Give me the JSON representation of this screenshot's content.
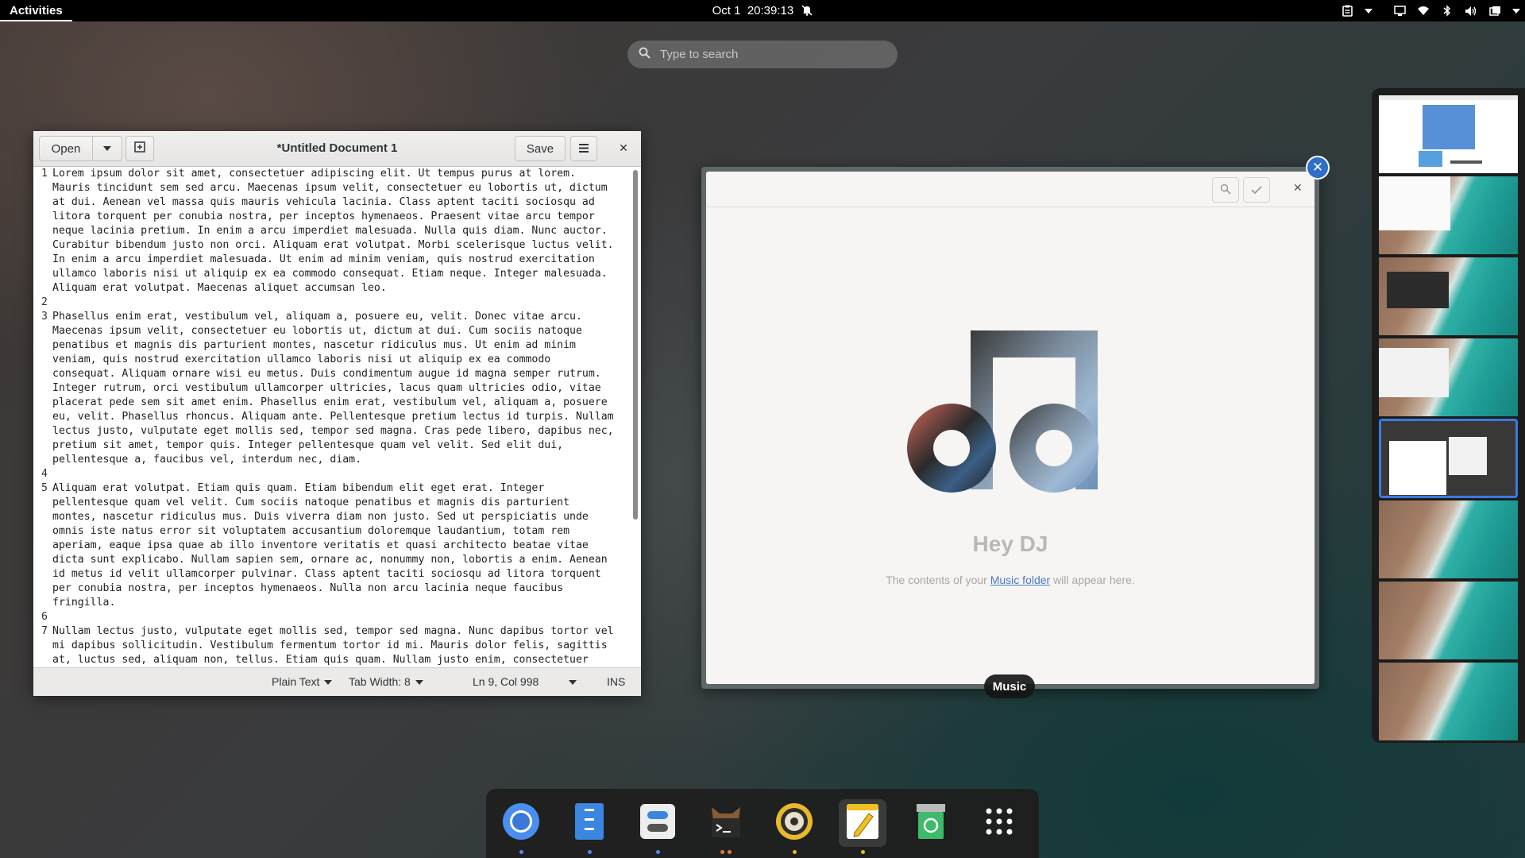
{
  "topbar": {
    "activities": "Activities",
    "date": "Oct 1",
    "time": "20:39:13",
    "icons": [
      "notifications-muted-icon",
      "clipboard-icon",
      "screen-icon",
      "wifi-icon",
      "bluetooth-icon",
      "volume-icon",
      "power-icon"
    ]
  },
  "search": {
    "placeholder": "Type to search"
  },
  "gedit": {
    "open_label": "Open",
    "save_label": "Save",
    "title": "*Untitled Document 1",
    "line_numbers": [
      "1",
      "",
      "",
      "",
      "",
      "",
      "",
      "",
      "",
      "2",
      "3",
      "",
      "",
      "",
      "",
      "",
      "",
      "",
      "",
      "",
      "",
      "4",
      "5",
      "",
      "",
      "",
      "",
      "",
      "",
      "",
      "",
      "6",
      "7",
      "",
      "",
      ""
    ],
    "paragraphs": [
      "Lorem ipsum dolor sit amet, consectetuer adipiscing elit. Ut tempus purus at lorem.\nMauris tincidunt sem sed arcu. Maecenas ipsum velit, consectetuer eu lobortis ut, dictum\nat dui. Aenean vel massa quis mauris vehicula lacinia. Class aptent taciti sociosqu ad\nlitora torquent per conubia nostra, per inceptos hymenaeos. Praesent vitae arcu tempor\nneque lacinia pretium. In enim a arcu imperdiet malesuada. Nulla quis diam. Nunc auctor.\nCurabitur bibendum justo non orci. Aliquam erat volutpat. Morbi scelerisque luctus velit.\nIn enim a arcu imperdiet malesuada. Ut enim ad minim veniam, quis nostrud exercitation\nullamco laboris nisi ut aliquip ex ea commodo consequat. Etiam neque. Integer malesuada.\nAliquam erat volutpat. Maecenas aliquet accumsan leo.",
      "Phasellus enim erat, vestibulum vel, aliquam a, posuere eu, velit. Donec vitae arcu.\nMaecenas ipsum velit, consectetuer eu lobortis ut, dictum at dui. Cum sociis natoque\npenatibus et magnis dis parturient montes, nascetur ridiculus mus. Ut enim ad minim\nveniam, quis nostrud exercitation ullamco laboris nisi ut aliquip ex ea commodo\nconsequat. Aliquam ornare wisi eu metus. Duis condimentum augue id magna semper rutrum.\nInteger rutrum, orci vestibulum ullamcorper ultricies, lacus quam ultricies odio, vitae\nplacerat pede sem sit amet enim. Phasellus enim erat, vestibulum vel, aliquam a, posuere\neu, velit. Phasellus rhoncus. Aliquam ante. Pellentesque pretium lectus id turpis. Nullam\nlectus justo, vulputate eget mollis sed, tempor sed magna. Cras pede libero, dapibus nec,\npretium sit amet, tempor quis. Integer pellentesque quam vel velit. Sed elit dui,\npellentesque a, faucibus vel, interdum nec, diam.",
      "Aliquam erat volutpat. Etiam quis quam. Etiam bibendum elit eget erat. Integer\npellentesque quam vel velit. Cum sociis natoque penatibus et magnis dis parturient\nmontes, nascetur ridiculus mus. Duis viverra diam non justo. Sed ut perspiciatis unde\nomnis iste natus error sit voluptatem accusantium doloremque laudantium, totam rem\naperiam, eaque ipsa quae ab illo inventore veritatis et quasi architecto beatae vitae\ndicta sunt explicabo. Nullam sapien sem, ornare ac, nonummy non, lobortis a enim. Aenean\nid metus id velit ullamcorper pulvinar. Class aptent taciti sociosqu ad litora torquent\nper conubia nostra, per inceptos hymenaeos. Nulla non arcu lacinia neque faucibus\nfringilla.",
      "Nullam lectus justo, vulputate eget mollis sed, tempor sed magna. Nunc dapibus tortor vel\nmi dapibus sollicitudin. Vestibulum fermentum tortor id mi. Mauris dolor felis, sagittis\nat, luctus sed, aliquam non, tellus. Etiam quis quam. Nullam justo enim, consectetuer\nnonummy, ornare vestibulum, lacinia velit. Aliquam ornare wisi eu metus. Nulla lacus."
    ],
    "status": {
      "language": "Plain Text",
      "tab_width": "Tab Width: 8",
      "position": "Ln 9, Col 998",
      "mode": "INS"
    }
  },
  "music": {
    "empty_title": "Hey DJ",
    "empty_desc_before": "The contents of your ",
    "empty_desc_link": "Music folder",
    "empty_desc_after": " will appear here.",
    "window_label": "Music"
  },
  "workspaces": {
    "count": 8,
    "selected_index": 4
  },
  "dock": {
    "apps": [
      "chromium",
      "files",
      "settings",
      "terminal",
      "music",
      "text-editor",
      "trash",
      "app-grid"
    ],
    "active_app": "text-editor"
  },
  "colors": {
    "accent": "#3b7ae0",
    "close_badge": "#2f6ec9",
    "link": "#4a7ac7"
  }
}
